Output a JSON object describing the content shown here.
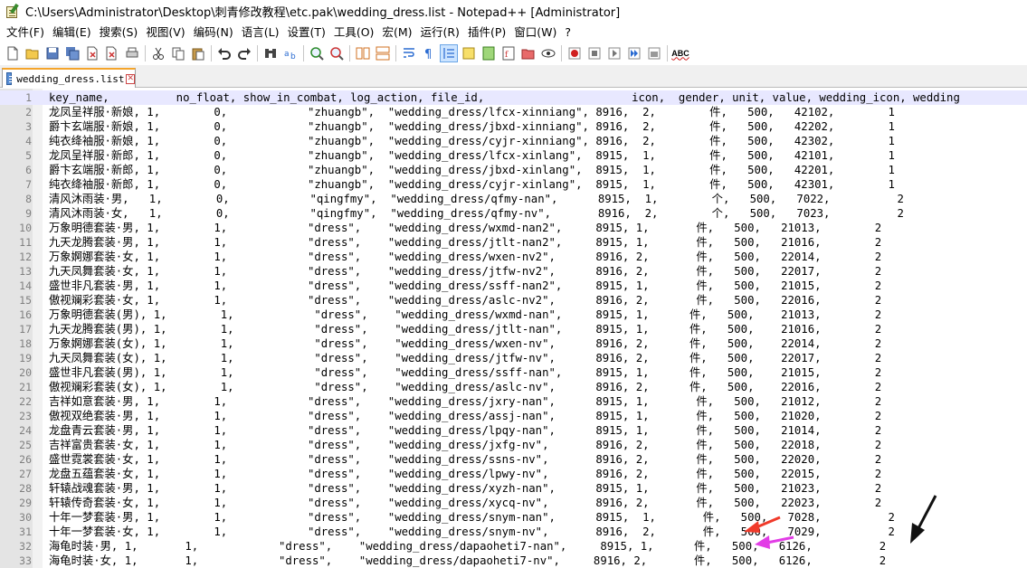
{
  "window": {
    "title": "C:\\Users\\Administrator\\Desktop\\刺青修改教程\\etc.pak\\wedding_dress.list - Notepad++ [Administrator]"
  },
  "menu": {
    "items": [
      {
        "label": "文件(F)"
      },
      {
        "label": "编辑(E)"
      },
      {
        "label": "搜索(S)"
      },
      {
        "label": "视图(V)"
      },
      {
        "label": "编码(N)"
      },
      {
        "label": "语言(L)"
      },
      {
        "label": "设置(T)"
      },
      {
        "label": "工具(O)"
      },
      {
        "label": "宏(M)"
      },
      {
        "label": "运行(R)"
      },
      {
        "label": "插件(P)"
      },
      {
        "label": "窗口(W)"
      },
      {
        "label": "?"
      }
    ]
  },
  "toolbar": {
    "icons": [
      "new-file-icon",
      "open-file-icon",
      "save-icon",
      "save-all-icon",
      "close-icon",
      "close-all-icon",
      "print-icon",
      "cut-icon",
      "copy-icon",
      "paste-icon",
      "undo-icon",
      "redo-icon",
      "find-icon",
      "replace-icon",
      "zoom-in-icon",
      "zoom-out-icon",
      "sync-vertical-icon",
      "sync-horizontal-icon",
      "word-wrap-icon",
      "show-all-chars-icon",
      "indent-guide-icon",
      "user-lang-icon",
      "doc-map-icon",
      "function-list-icon",
      "folder-workspace-icon",
      "monitor-icon",
      "record-macro-icon",
      "stop-macro-icon",
      "play-macro-icon",
      "run-macro-multiple-icon",
      "save-macro-icon",
      "spell-check-icon"
    ],
    "spellcheck_label": "ABC"
  },
  "tab": {
    "label": "wedding_dress.list",
    "close_glyph": "✕"
  },
  "editor": {
    "lines": [
      {
        "n": "1",
        "text": "key_name,          no_float, show_in_combat, log_action, file_id,                      icon,  gender, unit, value, wedding_icon, wedding"
      },
      {
        "n": "2",
        "text": "龙凤呈祥服·新娘, 1,        0,            \"zhuangb\",  \"wedding_dress/lfcx-xinniang\", 8916,  2,        件,   500,   42102,        1"
      },
      {
        "n": "3",
        "text": "爵卞玄端服·新娘, 1,        0,            \"zhuangb\",  \"wedding_dress/jbxd-xinniang\", 8916,  2,        件,   500,   42202,        1"
      },
      {
        "n": "4",
        "text": "纯衣绛袖服·新娘, 1,        0,            \"zhuangb\",  \"wedding_dress/cyjr-xinniang\", 8916,  2,        件,   500,   42302,        1"
      },
      {
        "n": "5",
        "text": "龙凤呈祥服·新郎, 1,        0,            \"zhuangb\",  \"wedding_dress/lfcx-xinlang\",  8915,  1,        件,   500,   42101,        1"
      },
      {
        "n": "6",
        "text": "爵卞玄端服·新郎, 1,        0,            \"zhuangb\",  \"wedding_dress/jbxd-xinlang\",  8915,  1,        件,   500,   42201,        1"
      },
      {
        "n": "7",
        "text": "纯衣绛袖服·新郎, 1,        0,            \"zhuangb\",  \"wedding_dress/cyjr-xinlang\",  8915,  1,        件,   500,   42301,        1"
      },
      {
        "n": "8",
        "text": "清风沐雨装·男,   1,        0,            \"qingfmy\",  \"wedding_dress/qfmy-nan\",      8915,  1,        个,   500,   7022,          2"
      },
      {
        "n": "9",
        "text": "清风沐雨装·女,   1,        0,            \"qingfmy\",  \"wedding_dress/qfmy-nv\",       8916,  2,        个,   500,   7023,          2"
      },
      {
        "n": "10",
        "text": "万象明德套装·男, 1,        1,            \"dress\",    \"wedding_dress/wxmd-nan2\",     8915, 1,       件,   500,   21013,        2"
      },
      {
        "n": "11",
        "text": "九天龙腾套装·男, 1,        1,            \"dress\",    \"wedding_dress/jtlt-nan2\",     8915, 1,       件,   500,   21016,        2"
      },
      {
        "n": "12",
        "text": "万象婀娜套装·女, 1,        1,            \"dress\",    \"wedding_dress/wxen-nv2\",      8916, 2,       件,   500,   22014,        2"
      },
      {
        "n": "13",
        "text": "九天凤舞套装·女, 1,        1,            \"dress\",    \"wedding_dress/jtfw-nv2\",      8916, 2,       件,   500,   22017,        2"
      },
      {
        "n": "14",
        "text": "盛世非凡套装·男, 1,        1,            \"dress\",    \"wedding_dress/ssff-nan2\",     8915, 1,       件,   500,   21015,        2"
      },
      {
        "n": "15",
        "text": "傲视斓彩套装·女, 1,        1,            \"dress\",    \"wedding_dress/aslc-nv2\",      8916, 2,       件,   500,   22016,        2"
      },
      {
        "n": "16",
        "text": "万象明德套装(男), 1,        1,            \"dress\",    \"wedding_dress/wxmd-nan\",     8915, 1,      件,   500,    21013,        2"
      },
      {
        "n": "17",
        "text": "九天龙腾套装(男), 1,        1,            \"dress\",    \"wedding_dress/jtlt-nan\",     8915, 1,      件,   500,    21016,        2"
      },
      {
        "n": "18",
        "text": "万象婀娜套装(女), 1,        1,            \"dress\",    \"wedding_dress/wxen-nv\",      8916, 2,      件,   500,    22014,        2"
      },
      {
        "n": "19",
        "text": "九天凤舞套装(女), 1,        1,            \"dress\",    \"wedding_dress/jtfw-nv\",      8916, 2,      件,   500,    22017,        2"
      },
      {
        "n": "20",
        "text": "盛世非凡套装(男), 1,        1,            \"dress\",    \"wedding_dress/ssff-nan\",     8915, 1,      件,   500,    21015,        2"
      },
      {
        "n": "21",
        "text": "傲视斓彩套装(女), 1,        1,            \"dress\",    \"wedding_dress/aslc-nv\",      8916, 2,      件,   500,    22016,        2"
      },
      {
        "n": "22",
        "text": "吉祥如意套装·男, 1,        1,            \"dress\",    \"wedding_dress/jxry-nan\",      8915, 1,       件,   500,   21012,        2"
      },
      {
        "n": "23",
        "text": "傲视双绝套装·男, 1,        1,            \"dress\",    \"wedding_dress/assj-nan\",      8915, 1,       件,   500,   21020,        2"
      },
      {
        "n": "24",
        "text": "龙盘青云套装·男, 1,        1,            \"dress\",    \"wedding_dress/lpqy-nan\",      8915, 1,       件,   500,   21014,        2"
      },
      {
        "n": "25",
        "text": "吉祥富贵套装·女, 1,        1,            \"dress\",    \"wedding_dress/jxfg-nv\",       8916, 2,       件,   500,   22018,        2"
      },
      {
        "n": "26",
        "text": "盛世霓裳套装·女, 1,        1,            \"dress\",    \"wedding_dress/ssns-nv\",       8916, 2,       件,   500,   22020,        2"
      },
      {
        "n": "27",
        "text": "龙盘五蕴套装·女, 1,        1,            \"dress\",    \"wedding_dress/lpwy-nv\",       8916, 2,       件,   500,   22015,        2"
      },
      {
        "n": "28",
        "text": "轩辕战魂套装·男, 1,        1,            \"dress\",    \"wedding_dress/xyzh-nan\",      8915, 1,       件,   500,   21023,        2"
      },
      {
        "n": "29",
        "text": "轩辕传奇套装·女, 1,        1,            \"dress\",    \"wedding_dress/xycq-nv\",       8916, 2,       件,   500,   22023,        2"
      },
      {
        "n": "30",
        "text": "十年一梦套装·男, 1,        1,            \"dress\",    \"wedding_dress/snym-nan\",      8915,  1,       件,   500,   7028,          2"
      },
      {
        "n": "31",
        "text": "十年一梦套装·女, 1,        1,            \"dress\",    \"wedding_dress/snym-nv\",       8916,  2,       件,   500,   7029,          2"
      },
      {
        "n": "32",
        "text": "海龟时装·男, 1,       1,            \"dress\",    \"wedding_dress/dapaoheti7-nan\",     8915, 1,      件,   500,   6126,          2"
      },
      {
        "n": "33",
        "text": "海龟时装·女, 1,       1,            \"dress\",    \"wedding_dress/dapaoheti7-nv\",     8916, 2,       件,   500,   6126,          2"
      }
    ]
  },
  "annotations": {
    "colors": {
      "red": "#f03a2a",
      "magenta": "#e23de6",
      "black": "#111111"
    }
  }
}
